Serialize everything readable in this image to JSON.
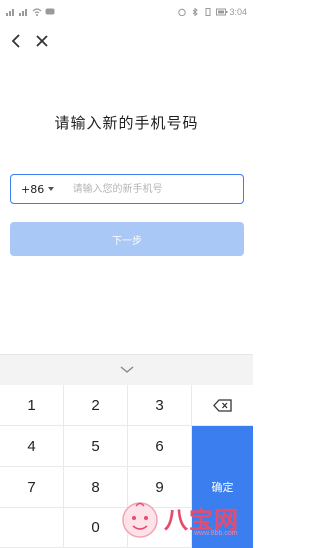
{
  "status": {
    "time": "3:04"
  },
  "nav": {
    "back_icon": "back-chevron-icon",
    "close_icon": "close-icon"
  },
  "title": "请输入新的手机号码",
  "phone": {
    "country_code": "+86",
    "placeholder": "请输入您的新手机号",
    "value": ""
  },
  "next_label": "下一步",
  "colors": {
    "accent": "#3b7ef0",
    "disabled_button": "#a9c8f5"
  },
  "keypad": {
    "rows": [
      [
        "1",
        "2",
        "3"
      ],
      [
        "4",
        "5",
        "6"
      ],
      [
        "7",
        "8",
        "9"
      ],
      [
        "",
        "0",
        ""
      ]
    ],
    "confirm_label": "确定",
    "delete_icon": "backspace-icon"
  },
  "watermark": {
    "brand": "八宝网",
    "site": "www.8bb.com"
  }
}
